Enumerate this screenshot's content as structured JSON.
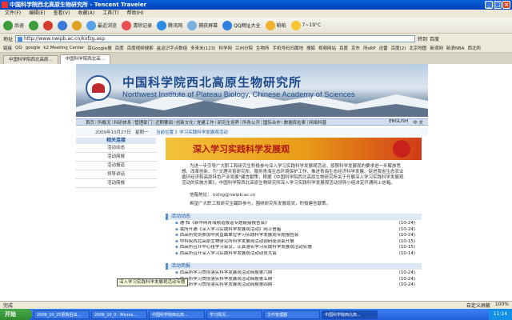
{
  "window": {
    "title": "中国科学院西北高原生物研究所 - Tencent Traveler"
  },
  "menu": [
    "文件(F)",
    "编辑(E)",
    "查看(V)",
    "收藏(A)",
    "工具(T)",
    "帮助(H)"
  ],
  "toolbar": {
    "back": "后退",
    "forward": "",
    "refresh": "",
    "home": "",
    "favorites": "最近浏览",
    "history": "清除记录",
    "tencent": "腾讯网",
    "screenshot": "捕获屏幕",
    "qq": "QQ网址大全",
    "weather": "帕帕",
    "temp": "7~19°C"
  },
  "address": {
    "label": "地址",
    "url": "http://www.nwipb.ac.cn/kxfzg.asp",
    "go": "转到",
    "baidu": "百度"
  },
  "links": [
    "链接",
    "QQ",
    "google",
    "k2 Meeting Center",
    "百Google搜",
    "百度",
    "百度视频搜索",
    "盒运识字点数组",
    "多来米(123)",
    "科学网",
    "兰州分院",
    "生物所",
    "手机号码归属地",
    "搜狐",
    "视频网站",
    "百度",
    "京东",
    "所sRP",
    "迅雷",
    "百度(2)",
    "北京地图",
    "新浪网",
    "新浪NBA",
    "西北所"
  ],
  "tabs": [
    {
      "label": "中国科学院西北高原...",
      "active": false
    },
    {
      "label": "中国科学院西北高...",
      "active": true
    }
  ],
  "site": {
    "title_cn": "中国科学院西北高原生物研究所",
    "title_en": "Northwest Institute of Plateau Biology, Chinese Academy of Sciences",
    "nav": [
      "首页",
      "所概况",
      "科研体系",
      "管理部门",
      "近期要闻",
      "创新文化",
      "党建工作",
      "研究生培养",
      "所务公开",
      "国际合作",
      "数据库检索",
      "网络科普"
    ],
    "lang": [
      "ENGLISH",
      "中 文"
    ],
    "date": "2009年10月27日　星期一",
    "breadcrumb": "当前位置 》学习实践科学发展观活动",
    "side_head": "相关连接",
    "side_items": [
      "活动动态",
      "活动简报",
      "活动报道",
      "领导讲话",
      "活动简报"
    ],
    "header_text": "深入学习实践科学发展观",
    "para1": "为进一步引导广大职工和研究生积极参与深入学习实践科学发展观活动，按照科学发展观的要求进一步解放思想、改革创新、为\"文理共育研究所、服务青海生态环境保护工作、推进青海生态经济科学发展、促进我省生态农业循环经济和高原特色产业发展\"建言献策，根据《中国科学院西北高原生物研究所关于开展深入学习实践科学发展观活动的实施方案》，中国科学院西北高原生物研究所深入学习实践科学发展观活动领导小组决定开通网上信箱。",
    "mail_label": "信箱地址：",
    "mail": "kxfzg@nwipb.ac.cn",
    "para2": "希望广大职工和研究生踊跃参与，围绕研究所发展现状，积极建言献策。",
    "news_head": "活动动态",
    "news": [
      {
        "t": "通 知《新华网青海频道报道专题链接报告会》",
        "d": "(10-24)"
      },
      {
        "t": "我所开通《深入学习实践科学发展观活动》网上信箱",
        "d": "(10-24)"
      },
      {
        "t": "西高所党员参加中央直属单位学习实践科学发展观专题报告会",
        "d": "(10-24)"
      },
      {
        "t": "中科院西北高原生物研究所科学发展观活动调研座谈会开展",
        "d": "(10-15)"
      },
      {
        "t": "西高所召开中心组学习会议，认真落实学习实践科学发展观活动实施",
        "d": "(10-15)"
      },
      {
        "t": "西高所召开深入学习实践科学发展观活动动员大会",
        "d": "(10-14)"
      }
    ],
    "brief_head": "活动简报",
    "briefs": [
      {
        "t": "西高所学习贯彻落实科学发展观活动简报第六期",
        "d": "(10-24)"
      },
      {
        "t": "西高所学习贯彻落实科学发展观活动简报第五期",
        "d": "(10-24)"
      },
      {
        "t": "西高所学习贯彻落实科学发展观活动简报第四期",
        "d": "(10-24)"
      }
    ],
    "tooltip": "深入学习实践科学发展观活动专题"
  },
  "status": {
    "left": "完成",
    "zoom": "100%",
    "mode": "自定义屏蔽"
  },
  "taskbar": {
    "start": "开始",
    "tasks": [
      "2009_10_25更新后出...",
      "2009_10_0 - Micros...",
      "中国科学院西北高...",
      "学习情况...",
      "文件管理器",
      "中国科学院西北高..."
    ],
    "clock": "11:14"
  }
}
